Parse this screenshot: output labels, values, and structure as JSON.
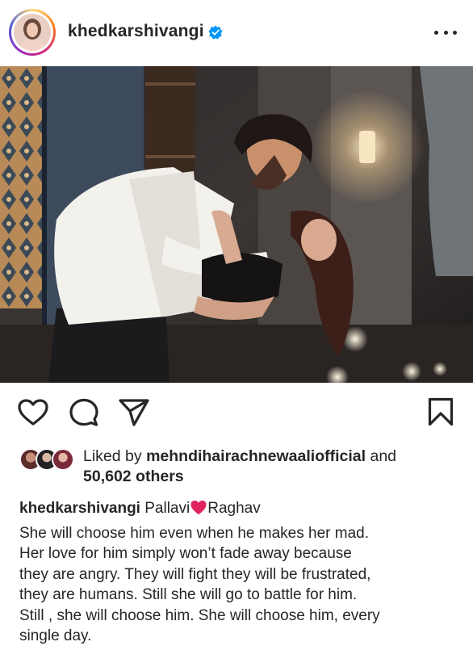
{
  "post": {
    "username": "khedkarshivangi",
    "verified": true,
    "avatar_icon": "avatar",
    "more_icon": "more-horizontal-icon"
  },
  "actions": {
    "like_icon": "heart-outline-icon",
    "comment_icon": "comment-bubble-icon",
    "share_icon": "send-paper-plane-icon",
    "save_icon": "bookmark-outline-icon"
  },
  "likes": {
    "prefix": "Liked by",
    "first_user": "mehndihairachnewaaliofficial",
    "joiner": "and",
    "others": "50,602 others"
  },
  "caption": {
    "username": "khedkarshivangi",
    "title_left": "Pallavi",
    "title_emoji": "red-heart-emoji",
    "title_right": "Raghav",
    "line1": "She will choose him even when he makes her mad.",
    "line2": "Her love for him simply won’t fade away because",
    "line3": "they are angry. They will fight they will be frustrated,",
    "line4": "they are humans. Still she will go to battle for him.",
    "line5": "Still , she will choose him. She will choose him, every",
    "line6": "single day."
  },
  "colors": {
    "text": "#262626",
    "verified_blue": "#0095f6",
    "heart_red": "#e0245e"
  }
}
